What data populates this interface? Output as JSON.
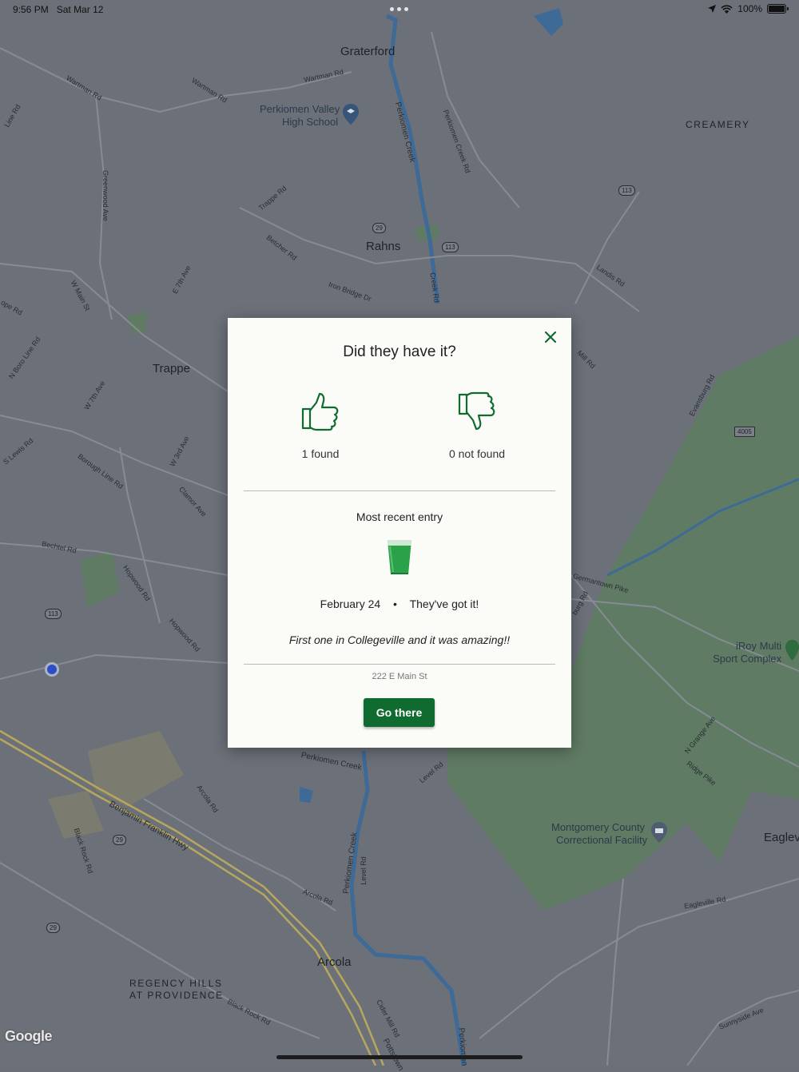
{
  "status_bar": {
    "time": "9:56 PM",
    "date": "Sat Mar 12",
    "battery": "100%"
  },
  "map": {
    "towns": [
      "Graterford",
      "Rahns",
      "Trappe",
      "Arcola",
      "Eaglev"
    ],
    "areas": [
      "CREAMERY",
      "REGENCY HILLS",
      "AT PROVIDENCE"
    ],
    "pois": {
      "school_line1": "Perkiomen Valley",
      "school_line2": "High School",
      "sport_line1": "iRoy Multi",
      "sport_line2": "Sport Complex",
      "corr_line1": "Montgomery County",
      "corr_line2": "Correctional Facility"
    },
    "roads": [
      "Wartman Rd",
      "Wartman Rd",
      "Wartman Rd",
      "Perkiomen Creek",
      "Perkiomen Creek Rd",
      "Trappe Rd",
      "Greenwood Ave",
      "Betcher Rd",
      "Iron Bridge Dr",
      "Creek Rd",
      "Landis Rd",
      "W Main St",
      "E 7th Ave",
      "W 7th Ave",
      "Borough Line Rd",
      "W 3rd Ave",
      "Clamor Ave",
      "Bechtel Rd",
      "Hopwood Rd",
      "Hopwood Rd",
      "S Lewis Rd",
      "N Boro Line Rd",
      "Mill Rd",
      "Evansburg Rd",
      "Germantown Pike",
      "N Grange Ave",
      "Ridge Pike",
      "Perkiomen Creek",
      "Level Rd",
      "Arcola Rd",
      "Benjamin Franklin Hwy",
      "Black Rock Rd",
      "Perkiomen Creek",
      "Level Rd",
      "Arcola Rd",
      "Black Rock Rd",
      "Cider Mill Rd",
      "Eagleville Rd",
      "Sunnyside Ave",
      "Pottstown",
      "Perkiomen",
      "ope Rd",
      "Line Rd",
      "burg Rd"
    ],
    "shields": [
      "29",
      "113",
      "113",
      "4005",
      "113",
      "29",
      "29"
    ],
    "attribution": "Google"
  },
  "modal": {
    "title": "Did they have it?",
    "found_label": "1 found",
    "not_found_label": "0 not found",
    "found_count": 1,
    "not_found_count": 0,
    "recent_heading": "Most recent entry",
    "entry_date": "February 24",
    "entry_separator": "•",
    "entry_status": "They've got it!",
    "comment": "First one in Collegeville and it was amazing!!",
    "address": "222 E Main St",
    "go_button": "Go there",
    "accent_color": "#0f6b2f"
  }
}
